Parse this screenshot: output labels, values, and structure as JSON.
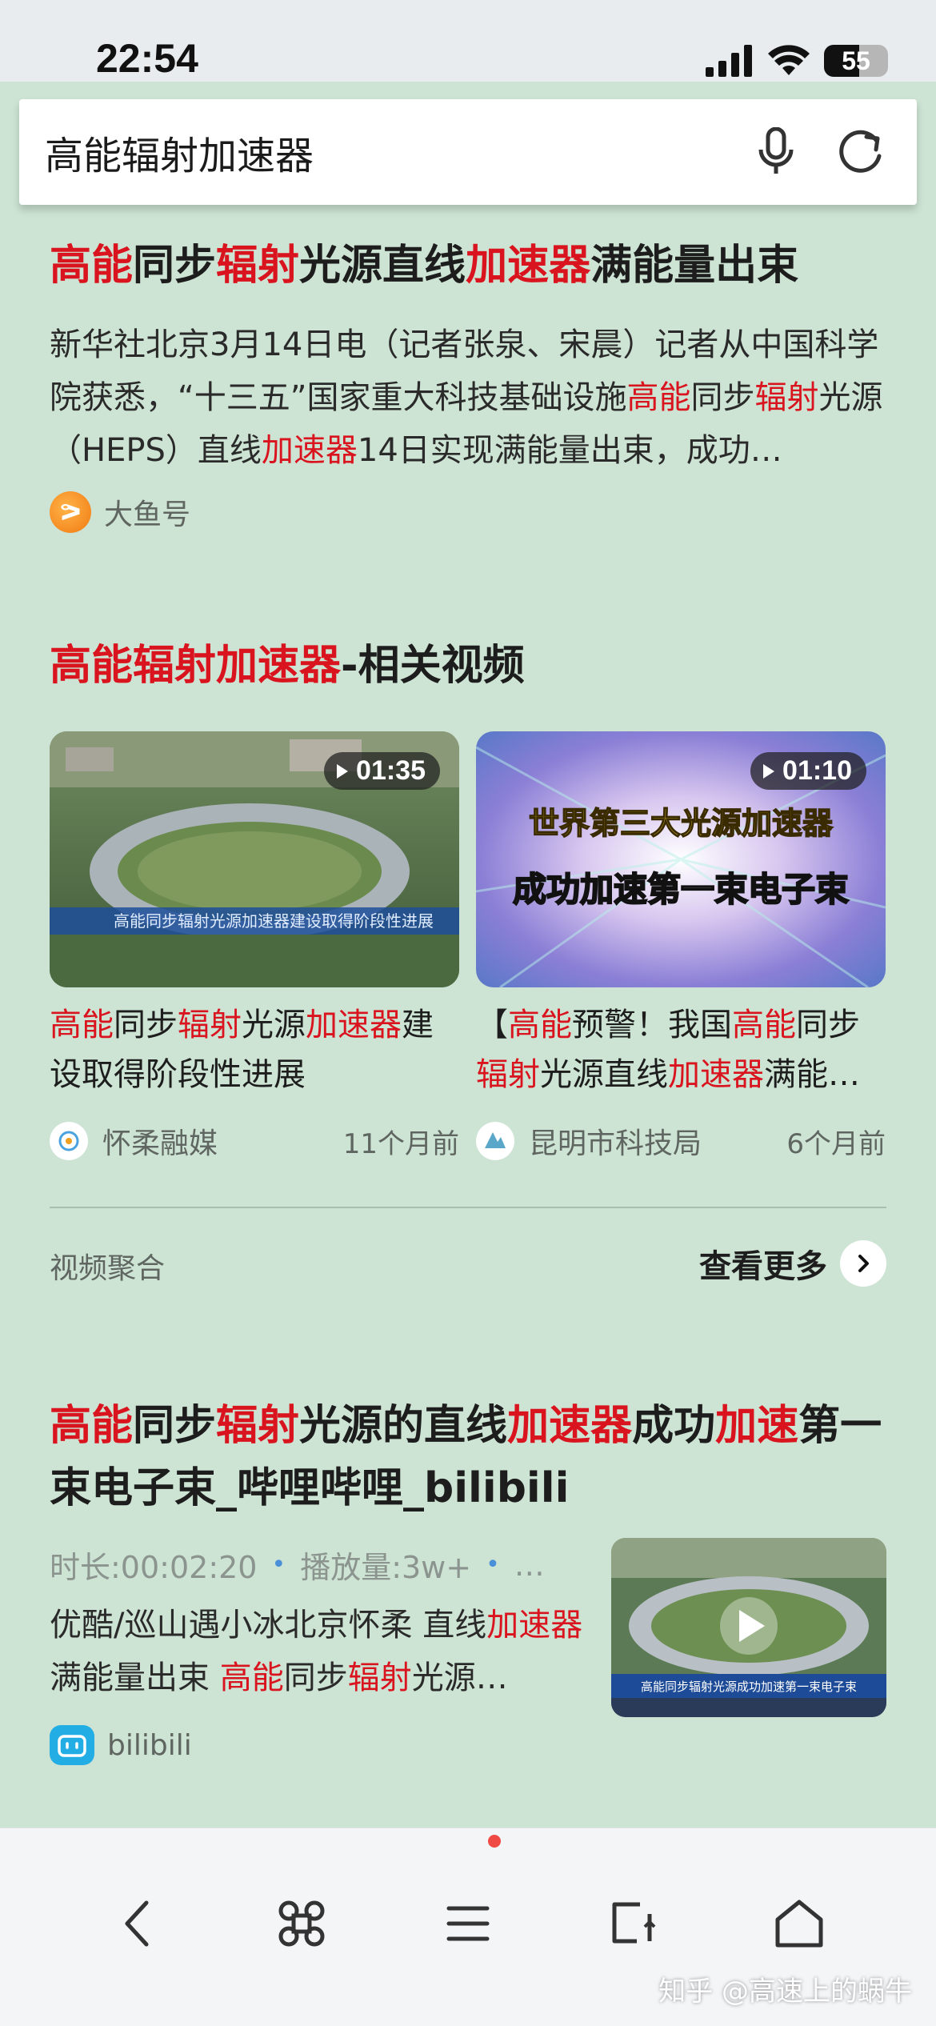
{
  "status_bar": {
    "time": "22:54",
    "battery": "55"
  },
  "search": {
    "query": "高能辐射加速器"
  },
  "result1": {
    "title_parts": [
      "高能",
      "同步",
      "辐射",
      "光源直线",
      "加速器",
      "满能量出束"
    ],
    "desc_parts": [
      "新华社北京3月14日电（记者张泉、宋晨）记者从中国科学院获悉，“十三五”国家重大科技基础设施",
      "高能",
      "同步",
      "辐射",
      "光源（HEPS）直线",
      "加速器",
      "14日实现满能量出束，成功…"
    ],
    "source": "大鱼号"
  },
  "video_section": {
    "title_parts": [
      "高能辐射加速器",
      "-相关视频"
    ],
    "videos": [
      {
        "duration": "01:35",
        "title_parts": [
          "高能",
          "同步",
          "辐射",
          "光源",
          "加速器",
          "建设取得阶段性进展"
        ],
        "source": "怀柔融媒",
        "time": "11个月前"
      },
      {
        "duration": "01:10",
        "thumb_text1": "世界第三大光源加速器",
        "thumb_text2": "成功加速第一束电子束",
        "title_parts": [
          "【",
          "高能",
          "预警！我国",
          "高能",
          "同步",
          "辐射",
          "光源直线",
          "加速器",
          "满能…"
        ],
        "source": "昆明市科技局",
        "time": "6个月前"
      }
    ],
    "aggregate_label": "视频聚合",
    "more_label": "查看更多"
  },
  "result3": {
    "title_parts": [
      "高能",
      "同步",
      "辐射",
      "光源的直线",
      "加速器",
      "成功",
      "加速",
      "第一束电子束_哔哩哔哩_bilibili"
    ],
    "duration": "时长:00:02:20",
    "plays": "播放量:3w+",
    "ellipsis": "…",
    "desc_parts": [
      "优酷/巡山遇小冰北京怀柔 直线",
      "加速器",
      "满能量出束 ",
      "高能",
      "同步",
      "辐射",
      "光源…"
    ],
    "source": "bilibili",
    "thumb_caption": "高能同步辐射光源成功加速第一束电子束"
  },
  "watermark": "知乎 @高速上的蜗牛",
  "colors": {
    "highlight": "#d9141e",
    "background": "#cde3d3"
  }
}
